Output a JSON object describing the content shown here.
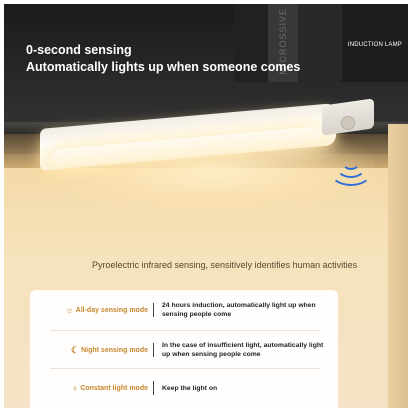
{
  "headline": {
    "line1": "0-second sensing",
    "line2": "Automatically lights up when someone comes"
  },
  "tag": "INDUCTION LAMP",
  "book_label": "MICROSSIVE",
  "caption": "Pyroelectric infrared sensing, sensitively identifies human activities",
  "modes": [
    {
      "icon": "sun-icon",
      "label": "All-day sensing mode",
      "description": "24 hours induction, automatically light up when sensing people come"
    },
    {
      "icon": "moon-icon",
      "label": "Night sensing mode",
      "description": "In the case of insufficient light, automatically light up when sensing people come"
    },
    {
      "icon": "bulb-icon",
      "label": "Constant light mode",
      "description": "Keep the light on"
    }
  ],
  "colors": {
    "accent": "#c7872e",
    "wave": "#2f6fd8",
    "shelf": "#1b1b1c"
  }
}
